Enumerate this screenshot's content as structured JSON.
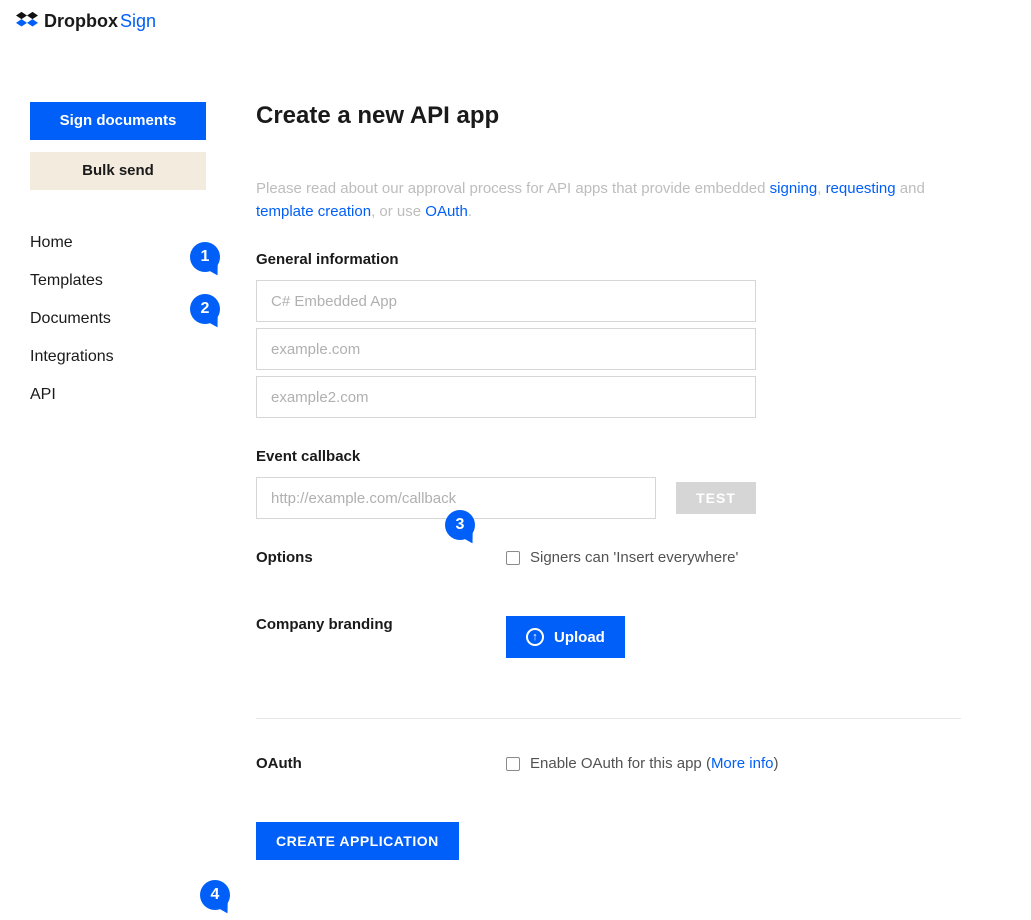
{
  "logo": {
    "brand": "Dropbox",
    "product": "Sign"
  },
  "sidebar": {
    "sign_documents": "Sign documents",
    "bulk_send": "Bulk send",
    "nav": [
      "Home",
      "Templates",
      "Documents",
      "Integrations",
      "API"
    ]
  },
  "page": {
    "title": "Create a new API app",
    "intro_prefix": "Please read about our approval process for API apps that provide embedded ",
    "link_signing": "signing",
    "comma_sep": ", ",
    "link_requesting": "requesting",
    "intro_and": " and ",
    "link_template": "template creation",
    "intro_oruse": ", or use ",
    "link_oauth": "OAuth",
    "period": "."
  },
  "general": {
    "label": "General information",
    "app_name_placeholder": "C# Embedded App",
    "domain1_placeholder": "example.com",
    "domain2_placeholder": "example2.com"
  },
  "callback": {
    "label": "Event callback",
    "placeholder": "http://example.com/callback",
    "test": "TEST"
  },
  "options": {
    "label": "Options",
    "checkbox_label": "Signers can 'Insert everywhere'"
  },
  "branding": {
    "label": "Company branding",
    "upload": "Upload"
  },
  "oauth": {
    "label": "OAuth",
    "checkbox_label": "Enable OAuth for this app (",
    "more_info": "More info",
    "close": ")"
  },
  "create": "CREATE APPLICATION",
  "badges": {
    "b1": "1",
    "b2": "2",
    "b3": "3",
    "b4": "4"
  }
}
